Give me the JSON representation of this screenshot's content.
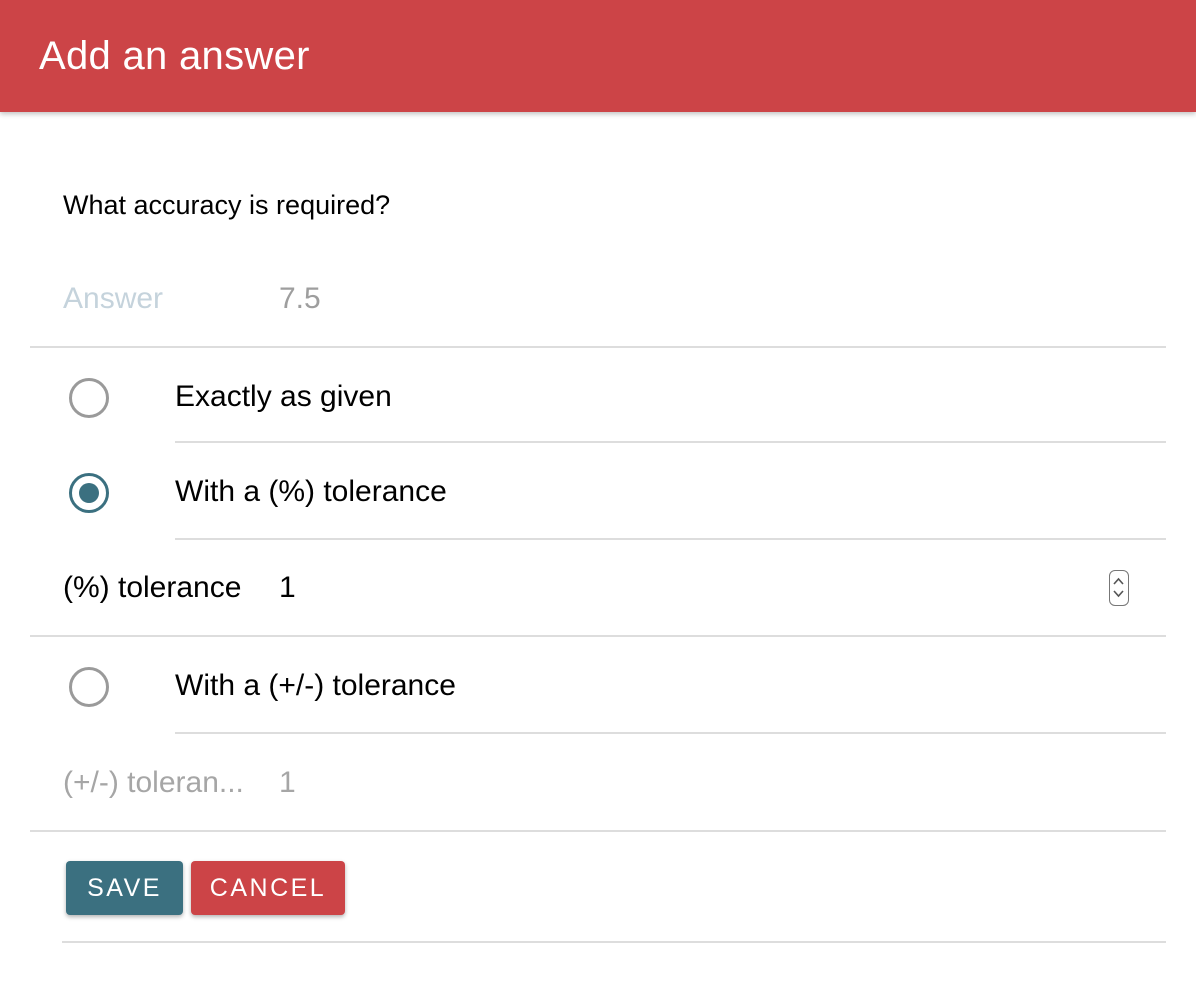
{
  "dialog": {
    "title": "Add an answer",
    "header_color": "#cc4447"
  },
  "question": "What accuracy is required?",
  "answer": {
    "label": "Answer",
    "value": "7.5"
  },
  "options": [
    {
      "label": "Exactly as given",
      "selected": false
    },
    {
      "label": "With a (%) tolerance",
      "selected": true
    },
    {
      "label": "With a (+/-) tolerance",
      "selected": false
    }
  ],
  "percent_tolerance": {
    "label": "(%) tolerance",
    "value": "1"
  },
  "plusminus_tolerance": {
    "label": "(+/-) toleran...",
    "value": "1"
  },
  "buttons": {
    "save_label": "SAVE",
    "cancel_label": "CANCEL"
  },
  "colors": {
    "accent": "#3b7080",
    "danger": "#cc4447"
  }
}
